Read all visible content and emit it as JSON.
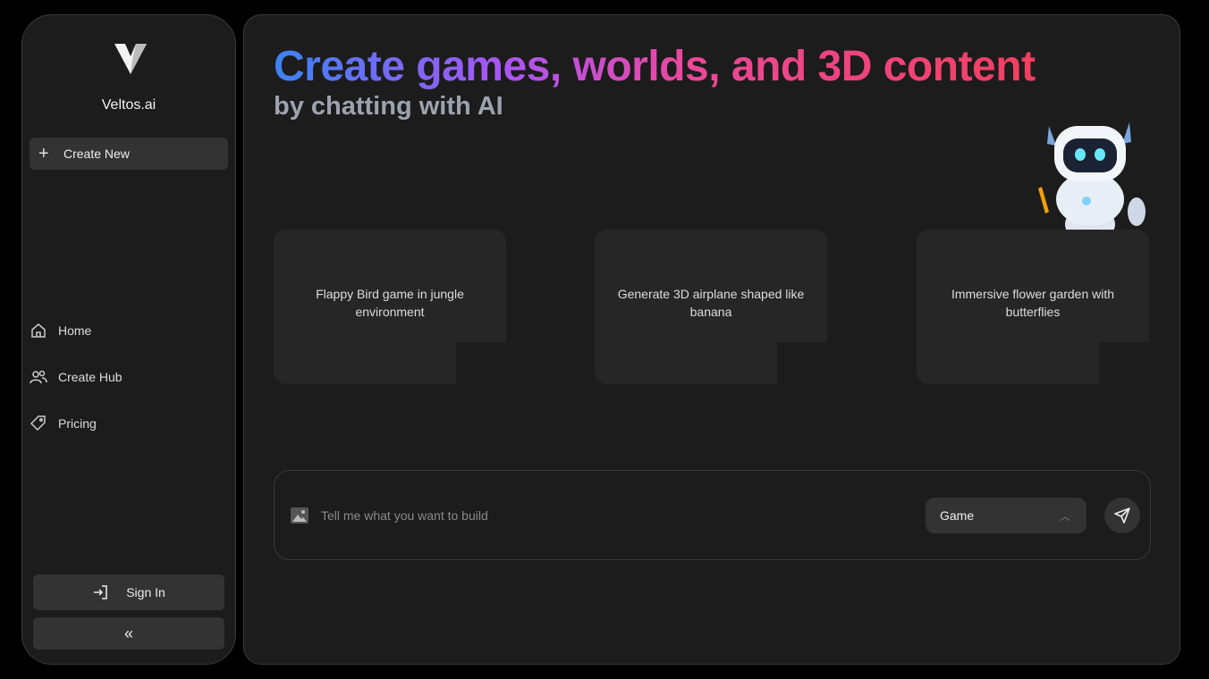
{
  "sidebar": {
    "brand": "Veltos.ai",
    "create_new": "Create New",
    "nav": [
      {
        "label": "Home",
        "icon": "home-icon"
      },
      {
        "label": "Create Hub",
        "icon": "users-icon"
      },
      {
        "label": "Pricing",
        "icon": "tag-icon"
      }
    ],
    "sign_in": "Sign In",
    "collapse": "«"
  },
  "main": {
    "title": "Create games, worlds, and 3D content",
    "subtitle": "by chatting with AI",
    "cards": [
      "Flappy Bird game in jungle environment",
      "Generate 3D airplane shaped like banana",
      "Immersive flower garden with butterflies"
    ],
    "prompt": {
      "placeholder": "Tell me what you want to build",
      "mode": "Game"
    }
  }
}
